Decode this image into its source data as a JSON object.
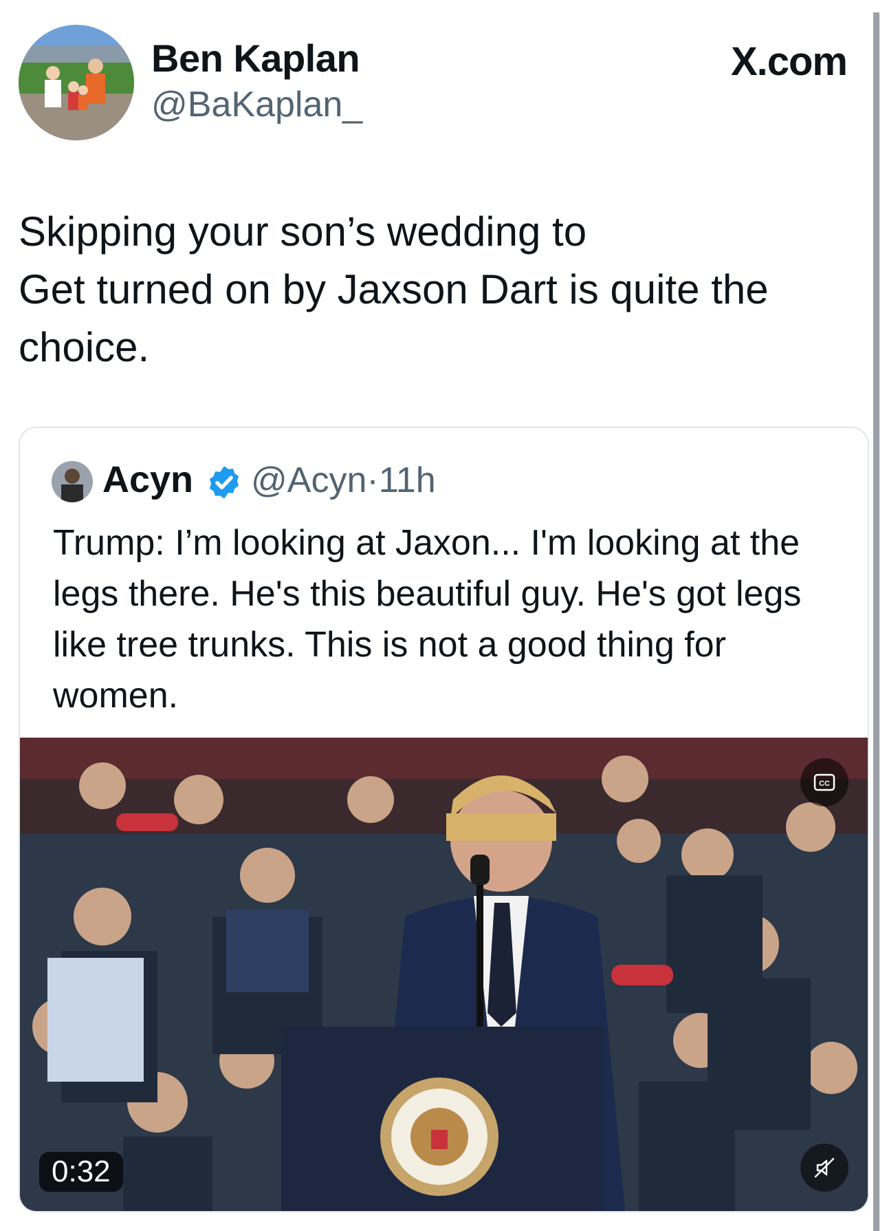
{
  "author": {
    "name": "Ben Kaplan",
    "handle": "@BaKaplan_",
    "avatar_icon": "user-avatar-baseball-stadium-photo"
  },
  "site_label": "X.com",
  "tweet": {
    "text": "Skipping your son’s wedding to\nGet turned on by Jaxson Dart is quite the\nchoice."
  },
  "quoted_tweet": {
    "name": "Acyn",
    "verified_icon": "verified-badge-icon",
    "handle": "@Acyn",
    "separator": "·",
    "time": "11h",
    "text": "Trump: I’m looking at Jaxon... I'm looking at the legs there. He's this beautiful guy. He's got legs like tree trunks. This is not a good thing for women.",
    "video": {
      "duration": "0:32",
      "captions_icon": "cc-icon",
      "mute_icon": "speaker-muted-icon"
    }
  },
  "colors": {
    "text": "#0f1419",
    "secondary": "#536471",
    "verified": "#1d9bf0",
    "border": "#e1e6ea"
  }
}
